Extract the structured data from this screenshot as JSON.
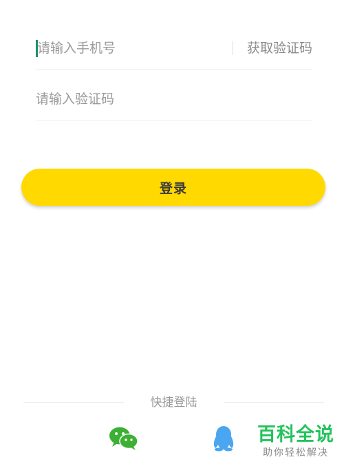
{
  "login_form": {
    "phone_placeholder": "请输入手机号",
    "get_code_label": "获取验证码",
    "code_placeholder": "请输入验证码",
    "login_label": "登录"
  },
  "quick_login": {
    "label": "快捷登陆",
    "options": [
      {
        "name": "wechat",
        "icon": "wechat-icon",
        "color": "#3cb034"
      },
      {
        "name": "qq",
        "icon": "qq-icon",
        "color": "#4aa6f0"
      }
    ]
  },
  "watermark": {
    "title": "百科全说",
    "subtitle": "助你轻松解决"
  },
  "colors": {
    "accent": "#ffd900",
    "caret": "#1b8f73",
    "wechat": "#3cb034",
    "qq": "#4aa6f0",
    "watermark": "#22c35b"
  }
}
